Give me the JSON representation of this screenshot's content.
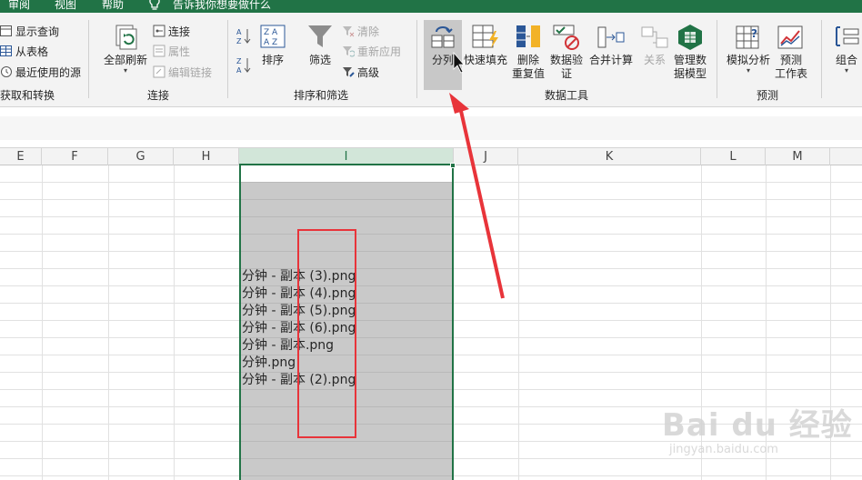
{
  "tabs": [
    "审阅",
    "视图",
    "帮助"
  ],
  "tell_me": "告诉我你想要做什么",
  "ribbon": {
    "get_transform": {
      "items": [
        "显示查询",
        "从表格",
        "最近使用的源"
      ],
      "label": "获取和转换"
    },
    "connections": {
      "refresh_all": "全部刷新",
      "items": [
        "连接",
        "属性",
        "编辑链接"
      ],
      "label": "连接"
    },
    "sort_filter": {
      "sort": "排序",
      "filter": "筛选",
      "items": [
        "清除",
        "重新应用",
        "高级"
      ],
      "label": "排序和筛选"
    },
    "data_tools": {
      "text_to_columns": "分列",
      "flash_fill": "快速填充",
      "remove_dup": [
        "删除",
        "重复值"
      ],
      "validation": [
        "数据验",
        "证"
      ],
      "consolidate": "合并计算",
      "relationships": "关系",
      "data_model": [
        "管理数",
        "据模型"
      ],
      "label": "数据工具"
    },
    "forecast": {
      "what_if": "模拟分析",
      "sheet": [
        "预测",
        "工作表"
      ],
      "label": "预测"
    },
    "outline": {
      "group": "组合"
    }
  },
  "columns": [
    "E",
    "F",
    "G",
    "H",
    "I",
    "J",
    "K",
    "L",
    "M"
  ],
  "cells": [
    "分钟 - 副本 (3).png",
    "分钟 - 副本 (4).png",
    "分钟 - 副本 (5).png",
    "分钟 - 副本 (6).png",
    "分钟 - 副本.png",
    "分钟.png",
    "分钟 - 副本 (2).png"
  ],
  "watermark": {
    "main": "Bai du 经验",
    "sub": "jingyan.baidu.com"
  },
  "colors": {
    "excel_green": "#217346",
    "annotation_red": "#e8343a"
  }
}
